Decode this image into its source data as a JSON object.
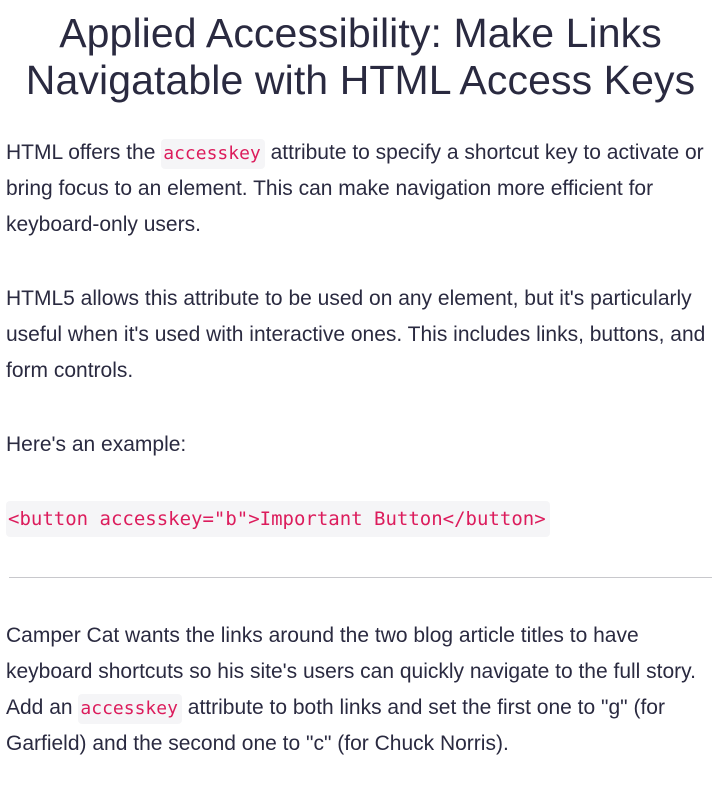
{
  "title": "Applied Accessibility: Make Links Navigatable with HTML Access Keys",
  "intro": {
    "part1": "HTML offers the ",
    "code": "accesskey",
    "part2": " attribute to specify a shortcut key to activate or bring focus to an element. This can make navigation more efficient for keyboard-only users."
  },
  "html5": "HTML5 allows this attribute to be used on any element, but it's particularly useful when it's used with interactive ones. This includes links, buttons, and form controls.",
  "example_label": "Here's an example:",
  "example_code": "<button accesskey=\"b\">Important Button</button>",
  "task": {
    "part1": "Camper Cat wants the links around the two blog article titles to have keyboard shortcuts so his site's users can quickly navigate to the full story. Add an ",
    "code": "accesskey",
    "part2": " attribute to both links and set the first one to \"g\" (for Garfield) and the second one to \"c\" (for Chuck Norris)."
  }
}
